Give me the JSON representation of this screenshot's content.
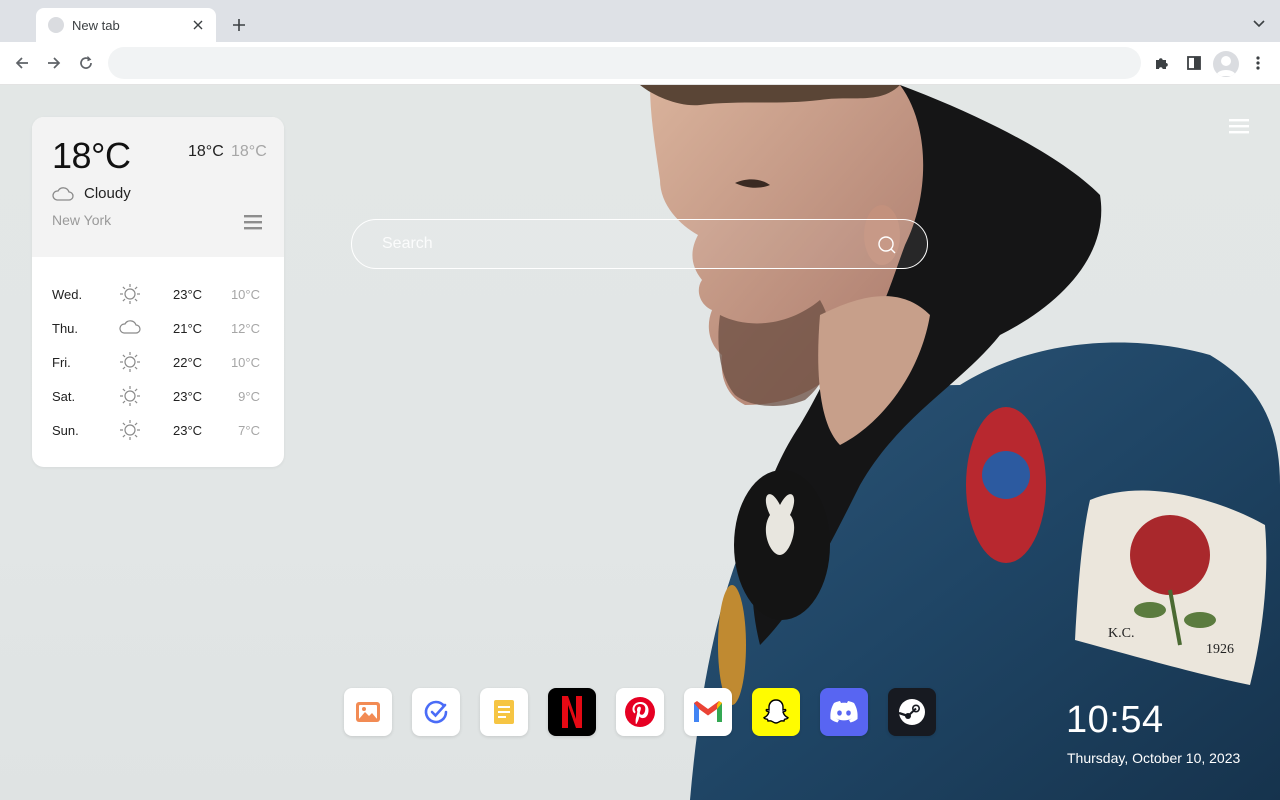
{
  "browser": {
    "tab": {
      "title": "New tab",
      "close_icon": "close-icon"
    },
    "new_tab_icon": "plus-icon",
    "tab_search_icon": "chevron-down-icon",
    "address_bar": {
      "value": "",
      "placeholder": ""
    },
    "nav_icons": [
      "back-arrow-icon",
      "forward-arrow-icon",
      "reload-icon"
    ],
    "toolbar_icons": [
      "extensions-puzzle-icon",
      "side-panel-icon",
      "profile-avatar-icon",
      "more-vertical-icon"
    ]
  },
  "weather": {
    "current_temp": "18°C",
    "high": "18°C",
    "low": "18°C",
    "condition": "Cloudy",
    "city": "New York",
    "forecast": [
      {
        "day": "Wed.",
        "icon": "sun-icon",
        "high": "23°C",
        "low": "10°C"
      },
      {
        "day": "Thu.",
        "icon": "cloud-icon",
        "high": "21°C",
        "low": "12°C"
      },
      {
        "day": "Fri.",
        "icon": "sun-icon",
        "high": "22°C",
        "low": "10°C"
      },
      {
        "day": "Sat.",
        "icon": "sun-icon",
        "high": "23°C",
        "low": "9°C"
      },
      {
        "day": "Sun.",
        "icon": "sun-icon",
        "high": "23°C",
        "low": "7°C"
      }
    ]
  },
  "search": {
    "placeholder": "Search"
  },
  "dock": {
    "apps": [
      {
        "name": "Photos",
        "icon": "image-icon"
      },
      {
        "name": "Tasks",
        "icon": "check-circle-icon"
      },
      {
        "name": "Notes",
        "icon": "note-icon"
      },
      {
        "name": "Netflix",
        "icon": "netflix-icon"
      },
      {
        "name": "Pinterest",
        "icon": "pinterest-icon"
      },
      {
        "name": "Gmail",
        "icon": "gmail-icon"
      },
      {
        "name": "Snapchat",
        "icon": "snapchat-icon"
      },
      {
        "name": "Discord",
        "icon": "discord-icon"
      },
      {
        "name": "Steam",
        "icon": "steam-icon"
      }
    ]
  },
  "clock": {
    "time": "10:54",
    "date": "Thursday, October 10, 2023"
  },
  "colors": {
    "netflix": "#e50914",
    "pinterest": "#e60023",
    "snapchat": "#fffc00",
    "discord": "#5865f2",
    "steam": "#171a21"
  }
}
